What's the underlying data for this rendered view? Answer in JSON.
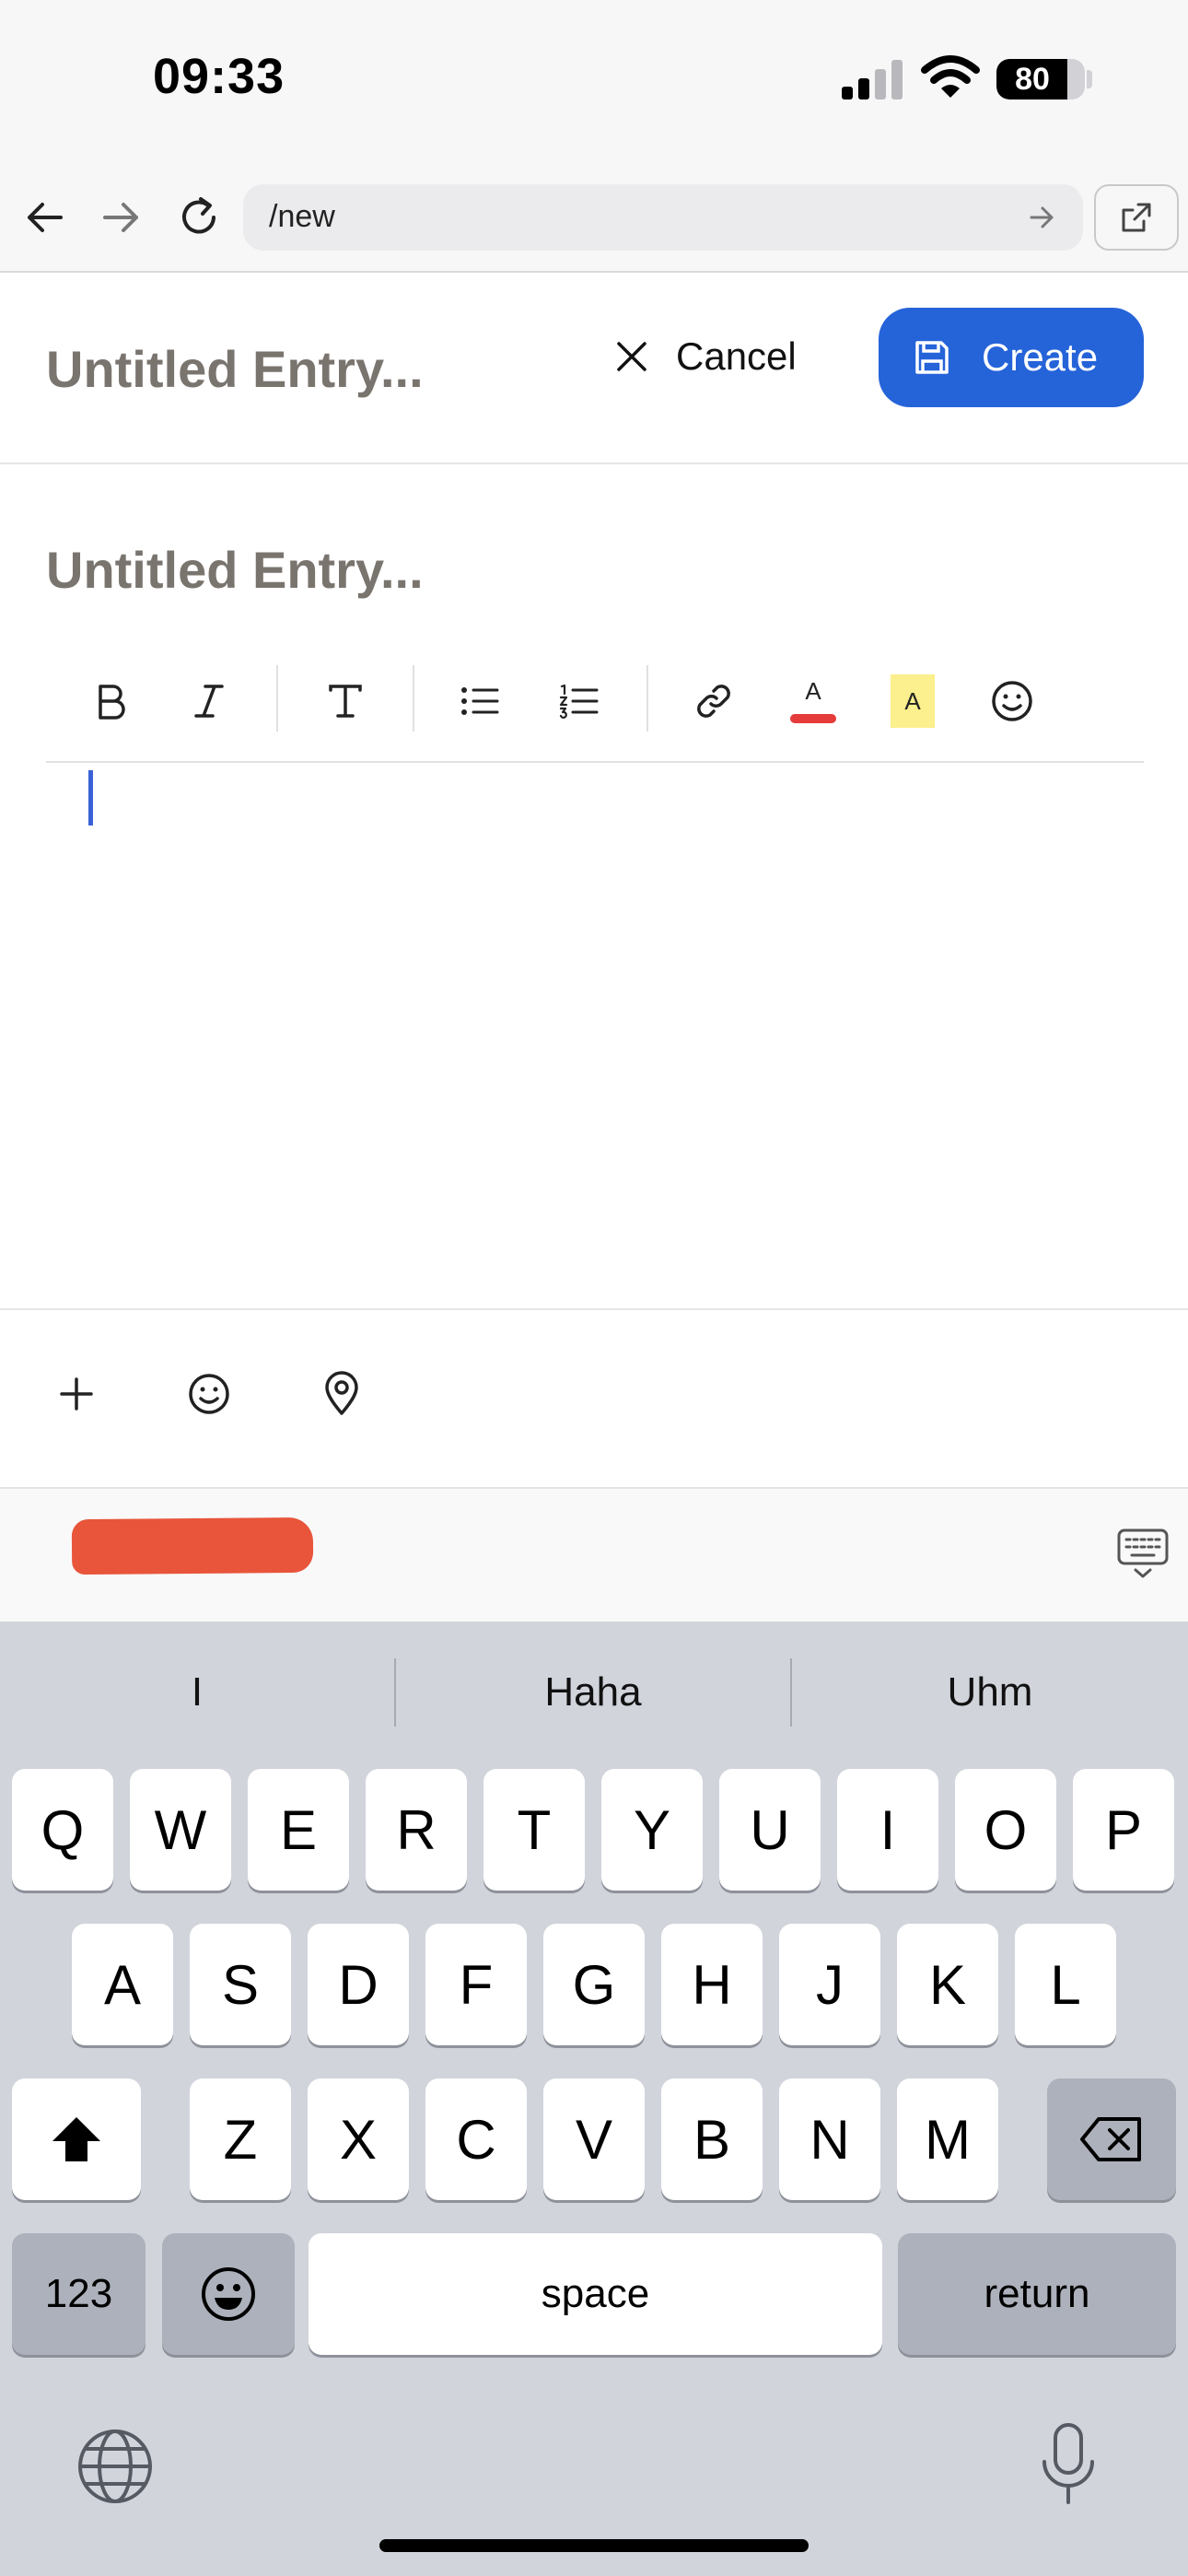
{
  "status_bar": {
    "time": "09:33",
    "battery_percent": 80,
    "battery_label": "80"
  },
  "browser": {
    "url": "/new",
    "icons": [
      "back-arrow-icon",
      "forward-arrow-icon",
      "reload-icon",
      "go-arrow-icon",
      "open-external-icon"
    ]
  },
  "header": {
    "title": "Untitled Entry...",
    "cancel_label": "Cancel",
    "create_label": "Create"
  },
  "editor": {
    "title_placeholder": "Untitled Entry...",
    "toolbar": [
      "bold-icon",
      "italic-icon",
      "text-style-icon",
      "bullet-list-icon",
      "numbered-list-icon",
      "link-icon",
      "text-color-icon",
      "highlight-icon",
      "emoji-icon"
    ],
    "text_color_letter": "A",
    "highlight_letter": "A"
  },
  "colors": {
    "accent": "#2563d9",
    "text_color_swatch": "#e63b3b",
    "highlight_swatch": "#fbef8e",
    "caret": "#3a62d6",
    "placeholder": "#7a746f"
  },
  "bottom_actions": [
    "add-icon",
    "emoji-icon",
    "location-pin-icon"
  ],
  "keyboard": {
    "suggestions": [
      "I",
      "Haha",
      "Uhm"
    ],
    "row1": [
      "Q",
      "W",
      "E",
      "R",
      "T",
      "Y",
      "U",
      "I",
      "O",
      "P"
    ],
    "row2": [
      "A",
      "S",
      "D",
      "F",
      "G",
      "H",
      "J",
      "K",
      "L"
    ],
    "row3": [
      "Z",
      "X",
      "C",
      "V",
      "B",
      "N",
      "M"
    ],
    "numbers_label": "123",
    "space_label": "space",
    "return_label": "return"
  }
}
